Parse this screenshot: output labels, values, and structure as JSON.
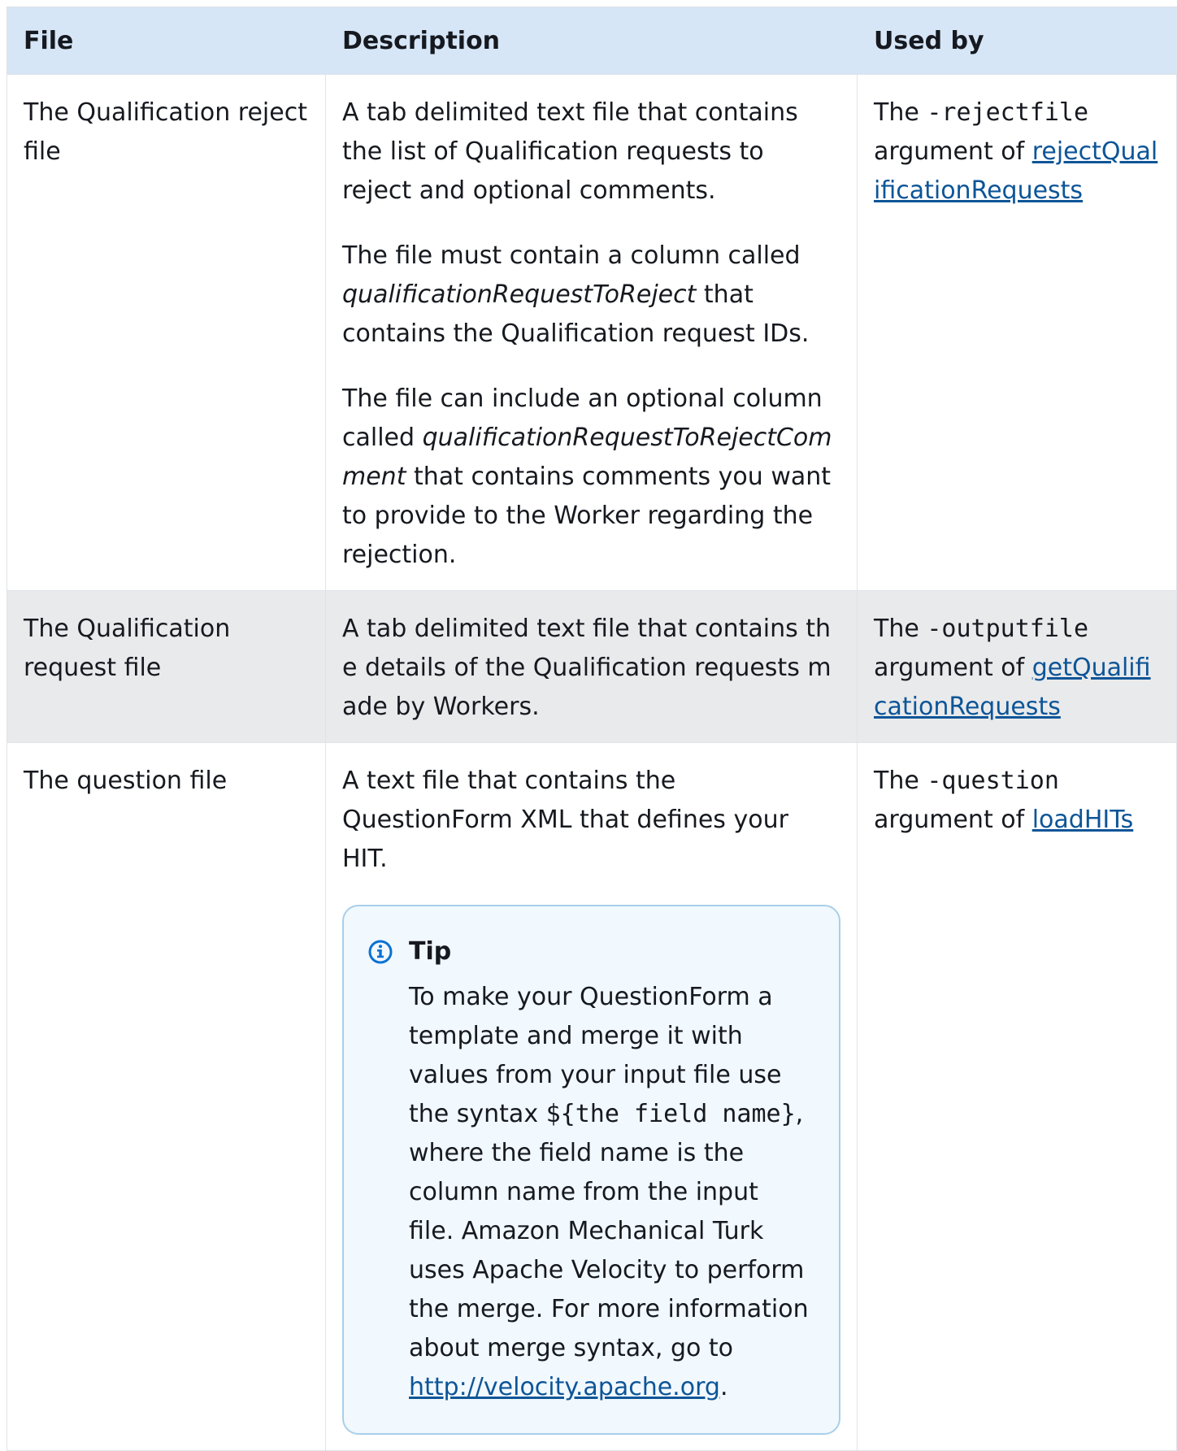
{
  "table": {
    "headers": [
      "File",
      "Description",
      "Used by"
    ],
    "rows": [
      {
        "file": "The Qualification reject file",
        "description": {
          "p1": "A tab delimited text file that contains the list of Qualification requests to reject and optional comments.",
          "p2_pre": "The file must contain a column called ",
          "p2_em": "qualificationRequestToReject",
          "p2_post": " that contains the Qualification request IDs.",
          "p3_pre": "The file can include an optional column called ",
          "p3_em": "qualificationRequestToRejectComment",
          "p3_post": " that contains comments you want to provide to the Worker regarding the rejection."
        },
        "used_by": {
          "pre": "The ",
          "code": "-rejectfile",
          "mid": " argument of ",
          "link": "rejectQualificationRequests"
        }
      },
      {
        "file": "The Qualification request file",
        "description": {
          "p1": "A tab delimited text file that contains the details of the Qualification requests made by Workers."
        },
        "used_by": {
          "pre": "The ",
          "code": "-outputfile",
          "mid": " argument of ",
          "link": "getQualificationRequests"
        }
      },
      {
        "file": "The question file",
        "description": {
          "p1": "A text file that contains the QuestionForm XML that defines your HIT.",
          "tip": {
            "icon": "info-icon",
            "title": "Tip",
            "text_pre": "To make your QuestionForm a template and merge it with values from your input file use the syntax ",
            "code": "${the field name}",
            "text_post": ", where the field name is the column name from the input file. Amazon Mechanical Turk uses Apache Velocity to perform the merge. For more information about merge syntax, go to ",
            "link": "http://velocity.apache.org",
            "end": "."
          }
        },
        "used_by": {
          "pre": "The ",
          "code": "-question",
          "mid": " argument of ",
          "link": "loadHITs"
        }
      }
    ]
  },
  "colors": {
    "header_bg": "#d6e6f7",
    "shaded_row_bg": "#e9eaec",
    "link": "#0d5597",
    "tip_bg": "#f1f8fe",
    "tip_border": "#a8cfe9",
    "info_icon": "#0972d3"
  }
}
